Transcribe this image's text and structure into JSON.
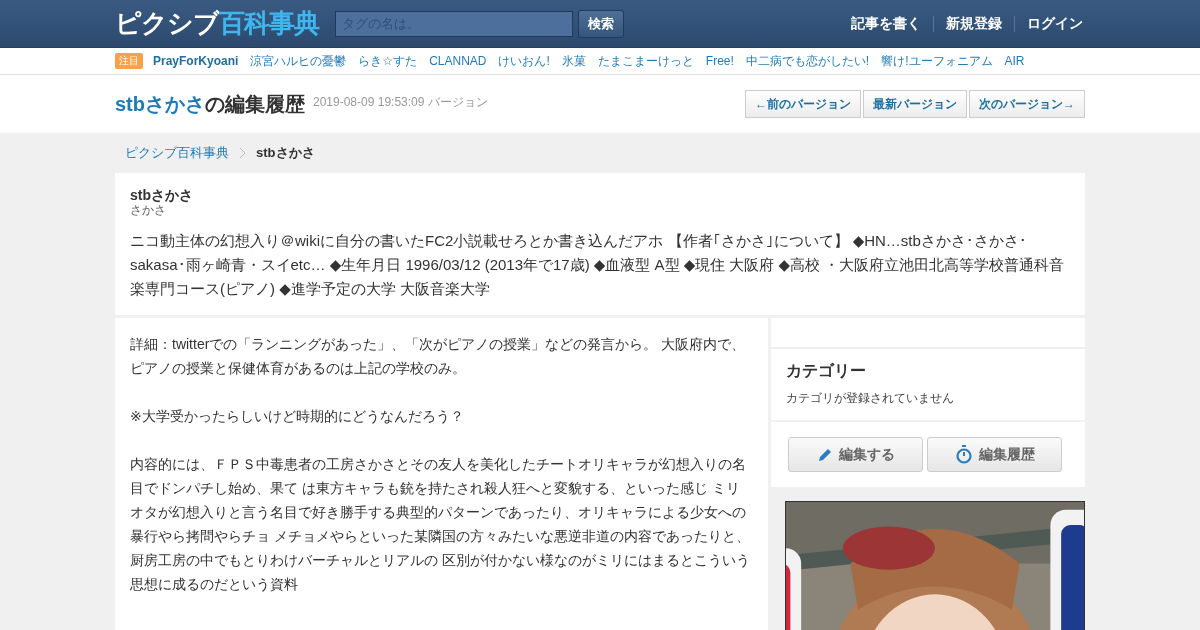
{
  "header": {
    "logo": {
      "part_1": "ピクシブ",
      "part_2": "百科事典"
    },
    "search": {
      "placeholder": "タグの名は。"
    },
    "search_button": "検索",
    "links": [
      "記事を書く",
      "新規登録",
      "ログイン"
    ]
  },
  "trending": {
    "badge": "注目",
    "tags": [
      {
        "label": "PrayForKyoani",
        "bold": true
      },
      {
        "label": "涼宮ハルヒの憂鬱",
        "bold": false
      },
      {
        "label": "らき☆すた",
        "bold": false
      },
      {
        "label": "CLANNAD",
        "bold": false
      },
      {
        "label": "けいおん!",
        "bold": false
      },
      {
        "label": "氷菓",
        "bold": false
      },
      {
        "label": "たまこまーけっと",
        "bold": false
      },
      {
        "label": "Free!",
        "bold": false
      },
      {
        "label": "中二病でも恋がしたい!",
        "bold": false
      },
      {
        "label": "響け!ユーフォニアム",
        "bold": false
      },
      {
        "label": "AIR",
        "bold": false
      }
    ]
  },
  "title": {
    "name": "stbさかさ",
    "suffix": "の編集履歴",
    "version": "2019-08-09 19:53:09 バージョン"
  },
  "version_buttons": [
    "←前のバージョン",
    "最新バージョン",
    "次のバージョン→"
  ],
  "breadcrumb": [
    {
      "label": "ピクシブ百科事典",
      "kind": "link"
    },
    {
      "label": "stbさかさ",
      "kind": "current"
    }
  ],
  "summary": {
    "title": "stbさかさ",
    "reading": "さかさ",
    "text": "ニコ動主体の幻想入り＠wikiに自分の書いたFC2小説載せろとか書き込んだアホ 【作者｢さかさ｣について】 ◆HN…stbさかさ･さかさ･sakasa･雨ヶ崎青・スイetc… ◆生年月日 1996/03/12 (2013年で17歳) ◆血液型 A型 ◆現住 大阪府 ◆高校 ・大阪府立池田北高等学校普通科音楽専門コース(ピアノ) ◆進学予定の大学 大阪音楽大学"
  },
  "article": [
    "詳細：twitterでの「ランニングがあった」、「次がピアノの授業」などの発言から。 大阪府内で、ピアノの授業と保健体育があるのは上記の学校のみ。",
    "※大学受かったらしいけど時期的にどうなんだろう？",
    "内容的には、ＦＰＳ中毒患者の工房さかさとその友人を美化したチートオリキャラが幻想入りの名目でドンパチし始め、果て は東方キャラも銃を持たされ殺人狂へと変貌する、といった感じ ミリオタが幻想入りと言う名目で好き勝手する典型的パターンであったり、オリキャラによる少女への暴行やら拷問やらチョ メチョメやらといった某隣国の方々みたいな悪逆非道の内容であったりと、厨房工房の中でもとりわけバーチャルとリアルの 区別が付かない様なのがミリにはまるとこういう思想に成るのだという資料"
  ],
  "sidebar": {
    "category_title": "カテゴリー",
    "category_empty": "カテゴリが登録されていません",
    "buttons": [
      {
        "label": "編集する",
        "kind": "edit"
      },
      {
        "label": "編集履歴",
        "kind": "history"
      }
    ]
  }
}
